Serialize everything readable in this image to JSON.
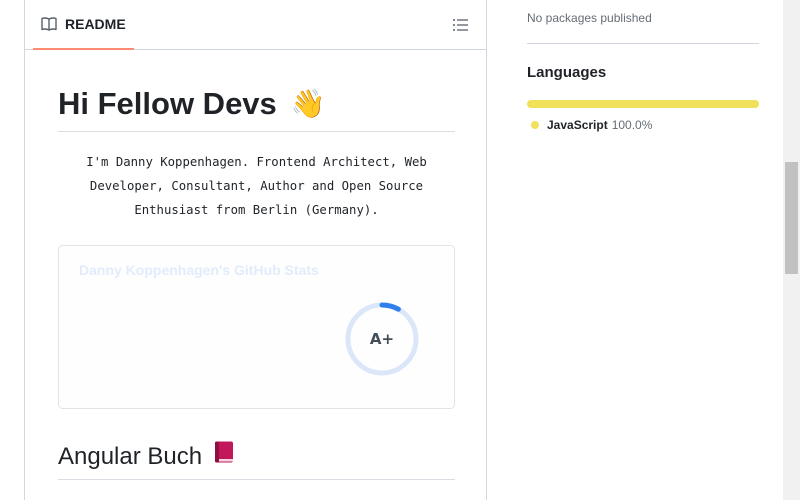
{
  "readme": {
    "tab_label": "README",
    "heading": "Hi Fellow Devs",
    "heading_emoji": "👋",
    "intro": "I'm Danny Koppenhagen. Frontend Architect, Web Developer, Consultant, Author and Open Source Enthusiast from Berlin (Germany).",
    "stats_card": {
      "title": "Danny Koppenhagen's GitHub Stats",
      "rank": "A+",
      "rank_progress": 0.08,
      "ring_color": "#2f80ed"
    },
    "subheading": "Angular Buch",
    "subheading_icon": "closed-book-icon"
  },
  "sidebar": {
    "packages_text": "No packages published",
    "languages_heading": "Languages",
    "languages": [
      {
        "name": "JavaScript",
        "percent": "100.0%",
        "value": 100,
        "color": "#f1e05a"
      }
    ]
  },
  "colors": {
    "tab_underline": "#fd8c73",
    "border": "#d0d7de"
  }
}
